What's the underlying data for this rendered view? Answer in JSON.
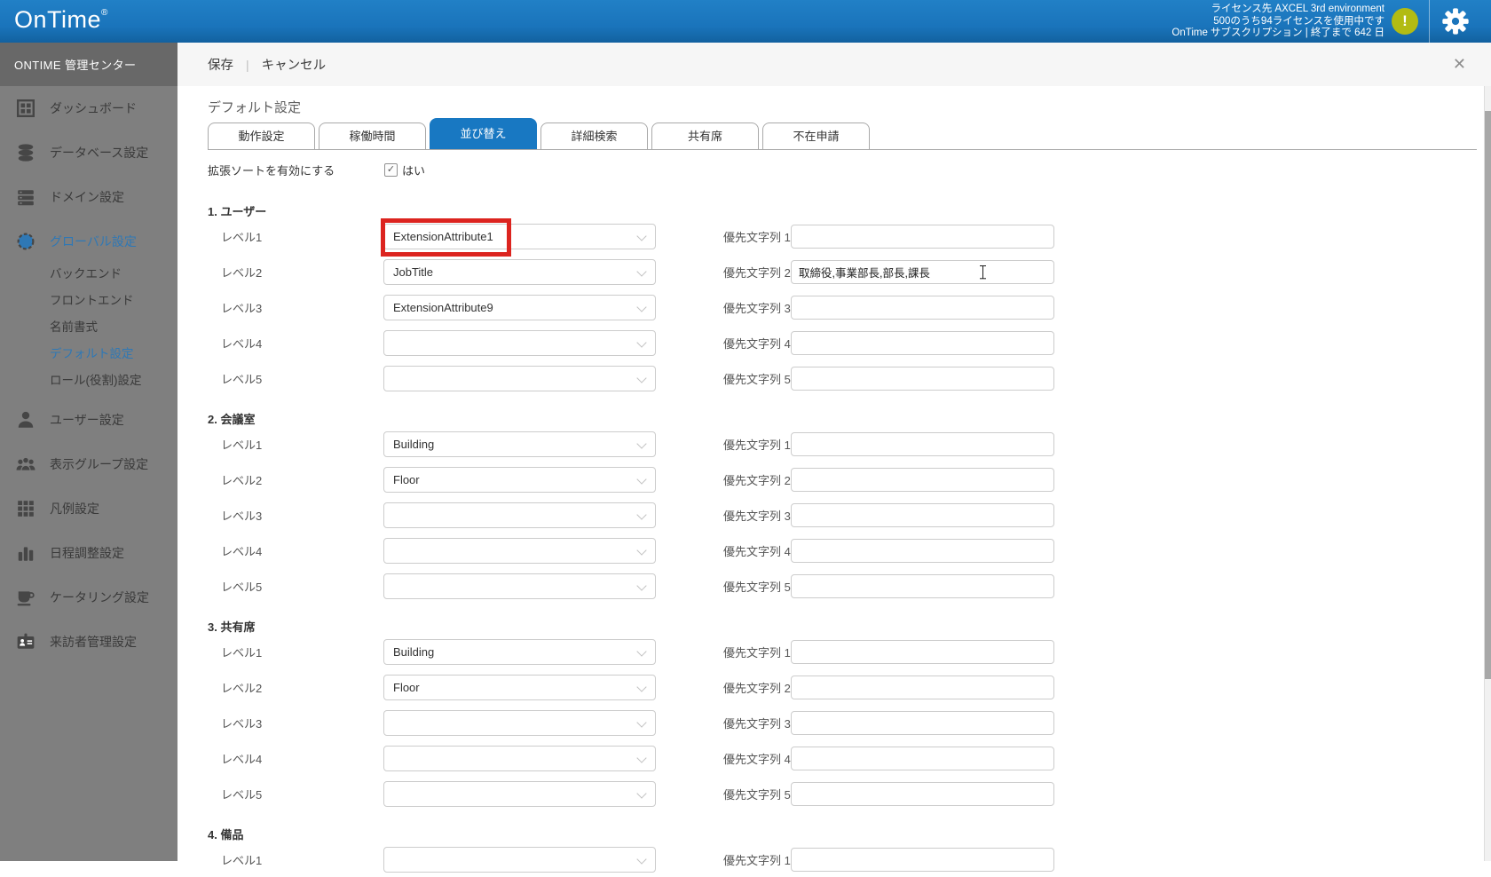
{
  "colors": {
    "topbar_blue": "#1a74bb",
    "accent_blue": "#1878c2",
    "sidebar_gray": "#7f7f7f",
    "warning_yellow": "#b2bb13",
    "highlight_red": "#dc241f"
  },
  "top_bar": {
    "logo": "OnTime",
    "logo_reg": "®",
    "license_line1": "ライセンス先 AXCEL 3rd environment",
    "license_line2": "500のうち94ライセンスを使用中です",
    "license_line3": "OnTime サブスクリプション | 終了まで 642 日",
    "warning_icon": "!"
  },
  "sidebar": {
    "header": "ONTIME 管理センター",
    "items": [
      {
        "label": "ダッシュボード",
        "icon": "dashboard-icon",
        "name": "sidebar-item-dashboard"
      },
      {
        "label": "データベース設定",
        "icon": "database-icon",
        "name": "sidebar-item-database"
      },
      {
        "label": "ドメイン設定",
        "icon": "domain-icon",
        "name": "sidebar-item-domain"
      },
      {
        "label": "グローバル設定",
        "icon": "globe-icon",
        "name": "sidebar-item-global",
        "active": true
      },
      {
        "label": "バックエンド",
        "sub": true,
        "firstSub": true,
        "name": "sidebar-item-backend"
      },
      {
        "label": "フロントエンド",
        "sub": true,
        "name": "sidebar-item-frontend"
      },
      {
        "label": "名前書式",
        "sub": true,
        "name": "sidebar-item-name-format"
      },
      {
        "label": "デフォルト設定",
        "sub": true,
        "active": true,
        "name": "sidebar-item-default-settings"
      },
      {
        "label": "ロール(役割)設定",
        "sub": true,
        "name": "sidebar-item-roles"
      },
      {
        "label": "ユーザー設定",
        "icon": "user-icon",
        "gap": true,
        "name": "sidebar-item-users"
      },
      {
        "label": "表示グループ設定",
        "icon": "group-icon",
        "name": "sidebar-item-display-groups"
      },
      {
        "label": "凡例設定",
        "icon": "legend-icon",
        "name": "sidebar-item-legend"
      },
      {
        "label": "日程調整設定",
        "icon": "chart-icon",
        "name": "sidebar-item-schedule-adjust"
      },
      {
        "label": "ケータリング設定",
        "icon": "catering-icon",
        "name": "sidebar-item-catering"
      },
      {
        "label": "来訪者管理設定",
        "icon": "visitor-icon",
        "name": "sidebar-item-visitor"
      }
    ]
  },
  "toolbar": {
    "save": "保存",
    "separator": "|",
    "cancel": "キャンセル",
    "close_icon": "✕"
  },
  "page": {
    "title": "デフォルト設定",
    "tabs": [
      {
        "label": "動作設定",
        "name": "tab-behavior"
      },
      {
        "label": "稼働時間",
        "name": "tab-working-hours"
      },
      {
        "label": "並び替え",
        "name": "tab-sort",
        "active": true
      },
      {
        "label": "詳細検索",
        "name": "tab-advanced-search"
      },
      {
        "label": "共有席",
        "name": "tab-shared-desk"
      },
      {
        "label": "不在申請",
        "name": "tab-absence-request"
      }
    ],
    "extended_sort": {
      "label": "拡張ソートを有効にする",
      "checked": true,
      "check_icon": "✓",
      "value": "はい"
    }
  },
  "form": {
    "level_labels": [
      "レベル1",
      "レベル2",
      "レベル3",
      "レベル4",
      "レベル5"
    ],
    "priority_labels": [
      "優先文字列 1",
      "優先文字列 2",
      "優先文字列 3",
      "優先文字列 4",
      "優先文字列 5"
    ],
    "sections": [
      {
        "title": "1. ユーザー",
        "levels": [
          "ExtensionAttribute1",
          "JobTitle",
          "ExtensionAttribute9",
          "",
          ""
        ],
        "priorities": [
          "",
          "取締役,事業部長,部長,課長",
          "",
          "",
          ""
        ],
        "highlight_level": 0,
        "cursor_priority": 1
      },
      {
        "title": "2. 会議室",
        "levels": [
          "Building",
          "Floor",
          "",
          "",
          ""
        ],
        "priorities": [
          "",
          "",
          "",
          "",
          ""
        ]
      },
      {
        "title": "3. 共有席",
        "levels": [
          "Building",
          "Floor",
          "",
          "",
          ""
        ],
        "priorities": [
          "",
          "",
          "",
          "",
          ""
        ]
      },
      {
        "title": "4. 備品",
        "levels": [
          ""
        ],
        "priorities": [
          ""
        ],
        "partial": true
      }
    ]
  }
}
